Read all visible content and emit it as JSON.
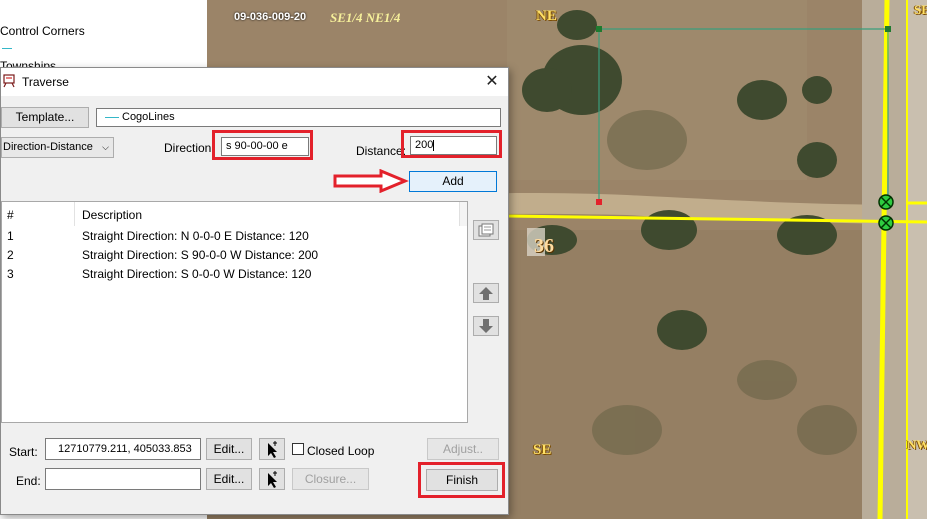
{
  "toc": {
    "item1": "Control Corners",
    "item2": "Townships"
  },
  "map": {
    "parcel_id": "09-036-009-20",
    "section_label": "SE1/4 NE1/4",
    "corner_ne": "NE",
    "corner_se": "SE",
    "corner_se_edge": "SE",
    "corner_nw_edge": "NW",
    "section_number": "36"
  },
  "dialog": {
    "title": "Traverse",
    "template_button": "Template...",
    "template_value": "CogoLines",
    "mode_select": "Direction-Distance",
    "direction_label": "Direction:",
    "direction_value": "s 90-00-00 e",
    "distance_label": "Distance:",
    "distance_value": "200",
    "add_button": "Add",
    "list": {
      "headers": [
        "#",
        "Description"
      ],
      "rows": [
        {
          "num": "1",
          "desc": "Straight  Direction: N 0-0-0 E  Distance: 120"
        },
        {
          "num": "2",
          "desc": "Straight  Direction: S 90-0-0 W  Distance: 200"
        },
        {
          "num": "3",
          "desc": "Straight  Direction: S 0-0-0 W  Distance: 120"
        }
      ]
    },
    "start_label": "Start:",
    "start_value": "12710779.211,  405033.853",
    "end_label": "End:",
    "end_value": "",
    "edit_button": "Edit...",
    "closed_loop_label": "Closed Loop",
    "adjust_button": "Adjust..",
    "closure_button": "Closure...",
    "finish_button": "Finish"
  },
  "colors": {
    "highlight": "#e3212b",
    "road_line": "#ffff00",
    "parcel_line": "#3a9e7c"
  }
}
